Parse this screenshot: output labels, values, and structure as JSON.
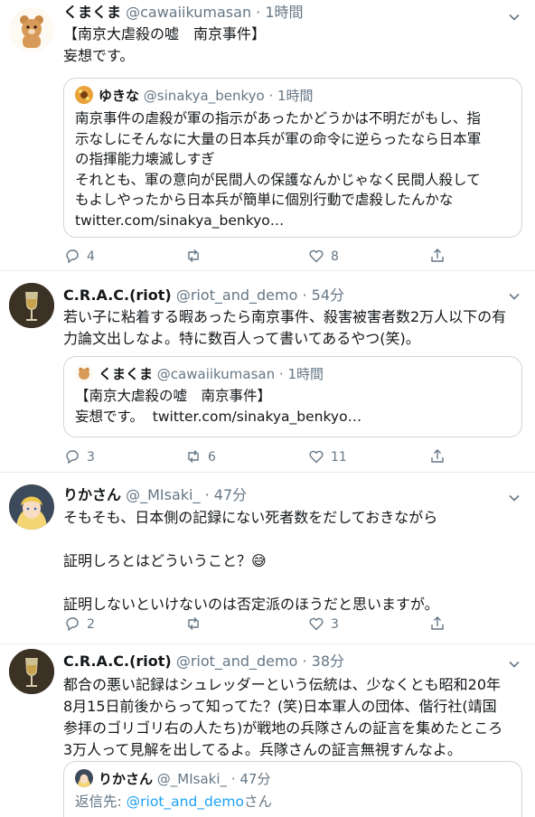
{
  "tweets": [
    {
      "name": "くまくま",
      "handle": "@cawaiikumasan",
      "sep": "·",
      "time": "1時間",
      "text": "【南京大虐殺の嘘　南京事件】\n妄想です。",
      "quote": {
        "name": "ゆきな",
        "handle": "@sinakya_benkyo",
        "sep": "·",
        "time": "1時間",
        "text": "南京事件の虐殺が軍の指示があったかどうかは不明だがもし、指\n示なしにそんなに大量の日本兵が軍の命令に逆らったなら日本軍\nの指揮能力壊滅しすぎ\nそれとも、軍の意向が民間人の保護なんかじゃなく民間人殺して\nもよしやったから日本兵が簡単に個別行動で虐殺したんかな\ntwitter.com/sinakya_benkyo…"
      },
      "actions": {
        "reply": "4",
        "retweet": "",
        "like": "8"
      }
    },
    {
      "name": "C.R.A.C.(riot)",
      "handle": "@riot_and_demo",
      "sep": "·",
      "time": "54分",
      "text": "若い子に粘着する暇あったら南京事件、殺害被害者数2万人以下の有\n力論文出しなよ。特に数百人って書いてあるやつ(笑)。",
      "quote": {
        "name": "くまくま",
        "handle": "@cawaiikumasan",
        "sep": "·",
        "time": "1時間",
        "text": "【南京大虐殺の嘘　南京事件】\n妄想です。  twitter.com/sinakya_benkyo…"
      },
      "actions": {
        "reply": "3",
        "retweet": "6",
        "like": "11"
      }
    },
    {
      "name": "りかさん",
      "handle": "@_MIsaki_",
      "sep": "·",
      "time": "47分",
      "text": "そもそも、日本側の記録にない死者数をだしておきながら\n\n証明しろとはどういうこと？😅\n\n証明しないといけないのは否定派のほうだと思いますが。",
      "actions": {
        "reply": "2",
        "retweet": "",
        "like": "3"
      }
    },
    {
      "name": "C.R.A.C.(riot)",
      "handle": "@riot_and_demo",
      "sep": "·",
      "time": "38分",
      "text": "都合の悪い記録はシュレッダーという伝統は、少なくとも昭和20年\n8月15日前後からって知ってた？(笑)日本軍人の団体、偕行社(靖国\n参拝のゴリゴリ右の人たち)が戦地の兵隊さんの証言を集めたところ\n3万人って見解を出してるよ。兵隊さんの証言無視すんなよ。",
      "quote": {
        "name": "りかさん",
        "handle": "@_MIsaki_",
        "sep": "·",
        "time": "47分",
        "reply_label": "返信先: ",
        "reply_to": "@riot_and_demo",
        "reply_suffix": "さん"
      }
    }
  ],
  "colors": {
    "text": "#14171a",
    "secondary": "#657786",
    "border": "#e6ecf0",
    "quote_border": "#ccd6dd"
  }
}
